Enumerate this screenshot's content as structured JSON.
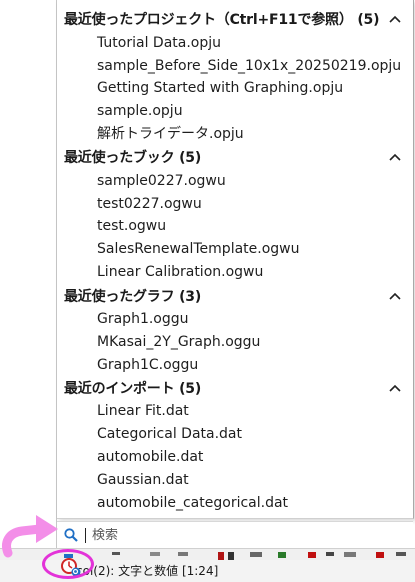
{
  "sections": [
    {
      "title": "最近使ったプロジェクト（Ctrl+F11で参照）",
      "count": "(5)",
      "items": [
        "Tutorial Data.opju",
        "sample_Before_Side_10x1x_20250219.opju",
        "Getting Started with Graphing.opju",
        "sample.opju",
        "解析トライデータ.opju"
      ]
    },
    {
      "title": "最近使ったブック",
      "count": "(5)",
      "items": [
        "sample0227.ogwu",
        "test0227.ogwu",
        "test.ogwu",
        "SalesRenewalTemplate.ogwu",
        "Linear Calibration.ogwu"
      ]
    },
    {
      "title": "最近使ったグラフ",
      "count": "(3)",
      "items": [
        "Graph1.oggu",
        "MKasai_2Y_Graph.oggu",
        "Graph1C.oggu"
      ]
    },
    {
      "title": "最近のインポート",
      "count": "(5)",
      "items": [
        "Linear Fit.dat",
        "Categorical Data.dat",
        "automobile.dat",
        "Gaussian.dat",
        "automobile_categorical.dat"
      ]
    }
  ],
  "search": {
    "placeholder": "検索",
    "value": ""
  },
  "statusbar": {
    "text": "col(2): 文字と数値 [1:24]"
  },
  "icons": {
    "search": "search-icon",
    "collapse": "chevron-up-icon",
    "recent": "recent-files-icon",
    "pointer": "arrow-pointer-icon"
  },
  "colors": {
    "highlight": "#e332d8",
    "arrow": "#f38ee8",
    "accent": "#1f6fc5"
  }
}
